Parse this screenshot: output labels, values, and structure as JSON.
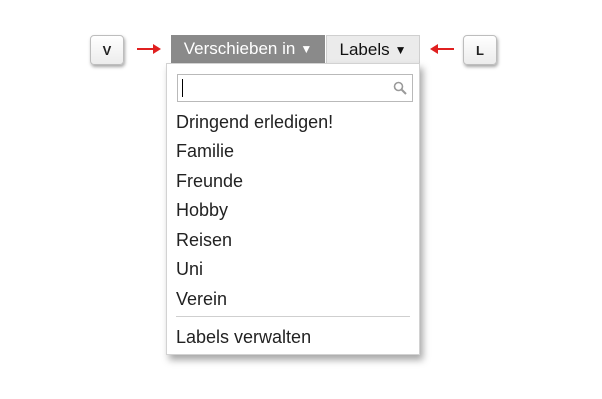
{
  "keys": {
    "v": "V",
    "l": "L"
  },
  "toolbar": {
    "move_label": "Verschieben in",
    "labels_label": "Labels",
    "caret": "▼"
  },
  "dropdown": {
    "search_placeholder": "",
    "items": [
      "Dringend erledigen!",
      "Familie",
      "Freunde",
      "Hobby",
      "Reisen",
      "Uni",
      "Verein"
    ],
    "manage_label": "Labels verwalten"
  },
  "colors": {
    "arrow": "#e02020",
    "move_bg": "#8a8a8a",
    "labels_bg": "#ebebeb"
  }
}
